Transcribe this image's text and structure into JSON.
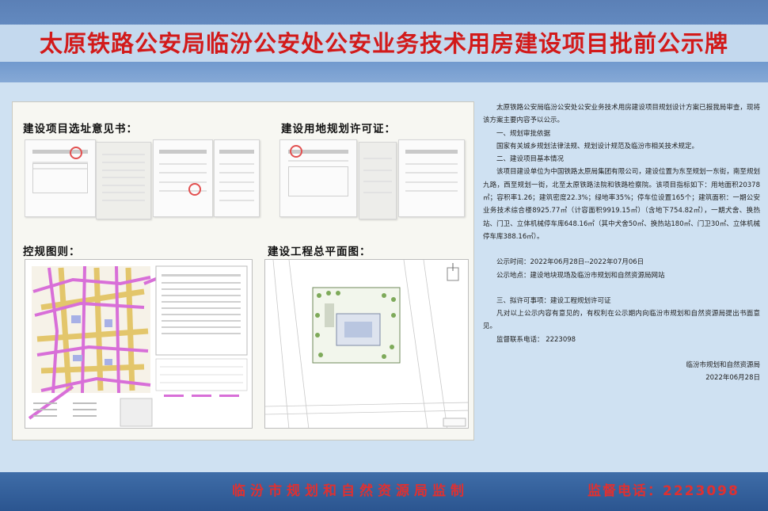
{
  "title": "太原铁路公安局临汾公安处公安业务技术用房建设项目批前公示牌",
  "sections": {
    "site_selection": "建设项目选址意见书：",
    "land_permit": "建设用地规划许可证：",
    "control_plan": "控规图则：",
    "site_plan": "建设工程总平面图："
  },
  "notice": {
    "intro": "太原铁路公安局临汾公安处公安业务技术用房建设项目规划设计方案已报我局审查，现将该方案主要内容予以公示。",
    "h1": "一、规划审批依据",
    "p1": "国家有关城乡规划法律法规、规划设计规范及临汾市相关技术规定。",
    "h2": "二、建设项目基本情况",
    "p2": "该项目建设单位为中国铁路太原局集团有限公司，建设位置为东至规划一东街，南至规划九路，西至规划一街，北至太原铁路法院和铁路检察院。该项目指标如下：用地面积20378㎡；容积率1.26；建筑密度22.3%；绿地率35%；停车位设置165个；建筑面积：一期公安业务技术综合楼8925.77㎡（计容面积9919.15㎡）（含地下754.82㎡），一期犬舍、换热站、门卫、立体机械停车库648.16㎡（其中犬舍50㎡、换热站180㎡、门卫30㎡、立体机械停车库388.16㎡）。",
    "time": "公示时间：2022年06月28日--2022年07月06日",
    "place": "公示地点：建设地块现场及临汾市规划和自然资源局网站",
    "h3": "三、拟许可事项：建设工程规划许可证",
    "p3": "凡对以上公示内容有意见的，有权利在公示期内向临汾市规划和自然资源局提出书面意见。",
    "phone": "监督联系电话：  2223098",
    "org": "临汾市规划和自然资源局",
    "date": "2022年06月28日"
  },
  "footer": {
    "left": "临汾市规划和自然资源局监制",
    "right": "监督电话：2223098"
  },
  "colors": {
    "title_red": "#d21a1a",
    "panel_bg": "#cfe1f2",
    "band_blue": "#6d96cc"
  }
}
